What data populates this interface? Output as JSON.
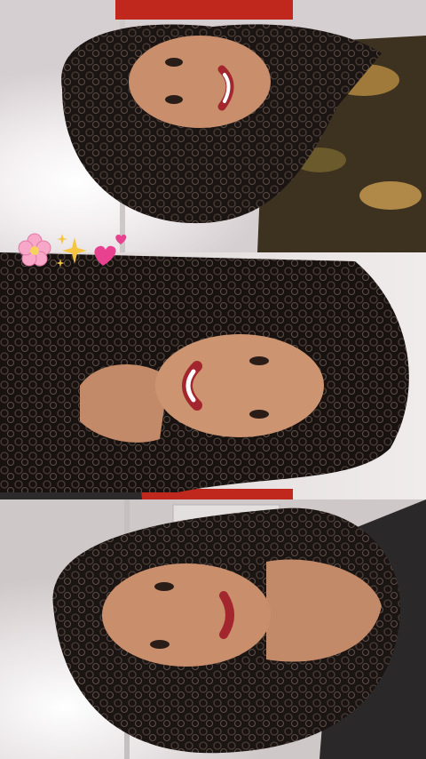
{
  "collage": {
    "panels": [
      {
        "orientation": "rotated-left",
        "expression": "smiling"
      },
      {
        "orientation": "rotated-right",
        "expression": "laughing"
      },
      {
        "orientation": "rotated-left",
        "expression": "soft smile"
      }
    ]
  },
  "stickers": [
    {
      "icon": "cherry-blossom-icon",
      "color": "#f7a8c8"
    },
    {
      "icon": "sparkles-icon",
      "color": "#f5c542"
    },
    {
      "icon": "pink-hearts-icon",
      "color": "#e8418f"
    }
  ],
  "colors": {
    "wall": "#efe9ea",
    "ceiling_red": "#c0281d",
    "hair": "#1a1412",
    "skin": "#c98f6c",
    "lips": "#a3262e"
  }
}
